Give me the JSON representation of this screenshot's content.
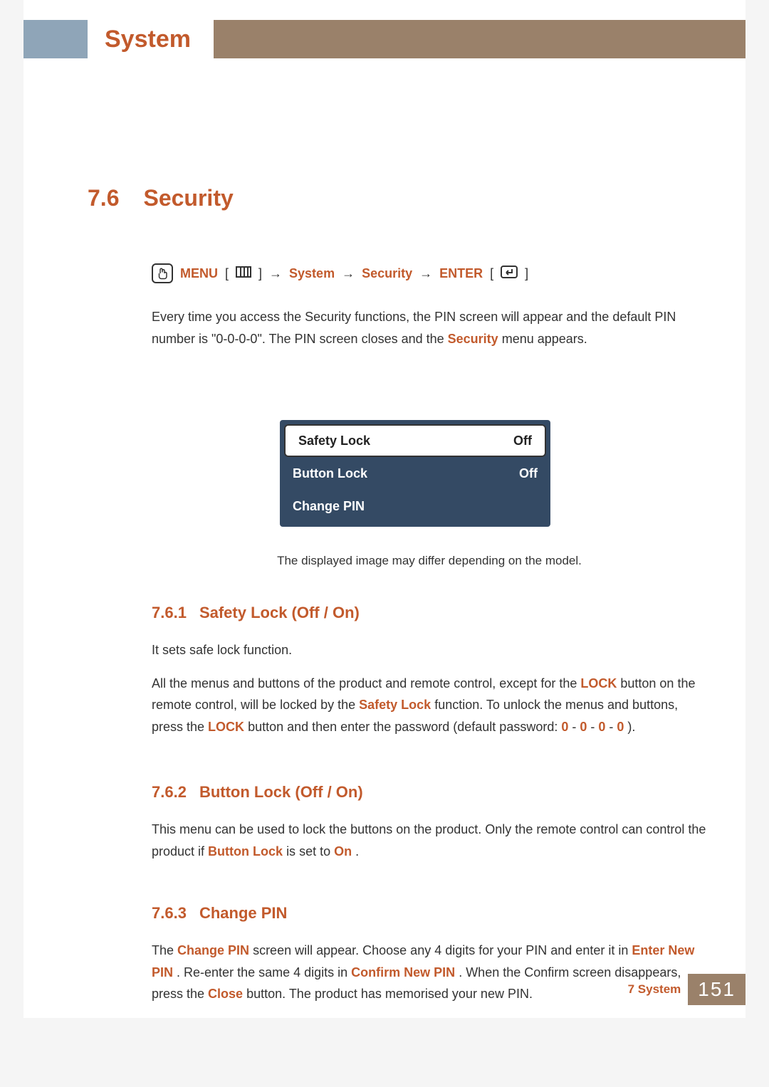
{
  "header": {
    "title": "System"
  },
  "section": {
    "number": "7.6",
    "title": "Security"
  },
  "breadcrumb": {
    "menu_label": "MENU",
    "menu_icon_glyph": "m",
    "menu_btn_glyph": "▥",
    "arrow": "→",
    "path1": "System",
    "path2": "Security",
    "enter_label": "ENTER",
    "enter_icon_glyph": "↲"
  },
  "intro": {
    "text1": "Every time you access the Security functions, the PIN screen will appear and the default PIN number is \"0-0-0-0\". The PIN screen closes and the ",
    "highlight": "Security",
    "text2": " menu appears."
  },
  "menu": {
    "rows": [
      {
        "label": "Safety Lock",
        "value": "Off",
        "selected": true
      },
      {
        "label": "Button Lock",
        "value": "Off",
        "selected": false
      },
      {
        "label": "Change PIN",
        "value": "",
        "selected": false
      }
    ]
  },
  "caption": "The displayed image may differ depending on the model.",
  "sub1": {
    "num": "7.6.1",
    "title": "Safety Lock (Off / On)",
    "p1": "It sets safe lock function.",
    "p2a": "All the menus and buttons of the product and remote control, except for the ",
    "p2_lock1": "LOCK",
    "p2b": " button on the remote control, will be locked by the ",
    "p2_sl": "Safety Lock",
    "p2c": " function. To unlock the menus and buttons, press the ",
    "p2_lock2": "LOCK",
    "p2d": " button and then enter the password (default password: ",
    "d0": "0",
    "dash": " - ",
    "p2e": ")."
  },
  "sub2": {
    "num": "7.6.2",
    "title": "Button Lock (Off / On)",
    "p1a": "This menu can be used to lock the buttons on the product. Only the remote control can control the product if ",
    "p1_bl": "Button Lock",
    "p1b": " is set to ",
    "p1_on": "On",
    "p1c": "."
  },
  "sub3": {
    "num": "7.6.3",
    "title": "Change PIN",
    "p1a": "The ",
    "p1_cp": "Change PIN",
    "p1b": " screen will appear. Choose any 4 digits for your PIN and enter it in ",
    "p1_enp": "Enter New PIN",
    "p1c": ". Re-enter the same 4 digits in ",
    "p1_cnp": "Confirm New PIN",
    "p1d": ". When the Confirm screen disappears, press the ",
    "p1_close": "Close",
    "p1e": " button. The product has memorised your new PIN."
  },
  "footer": {
    "chapter": "7 System",
    "page": "151"
  }
}
